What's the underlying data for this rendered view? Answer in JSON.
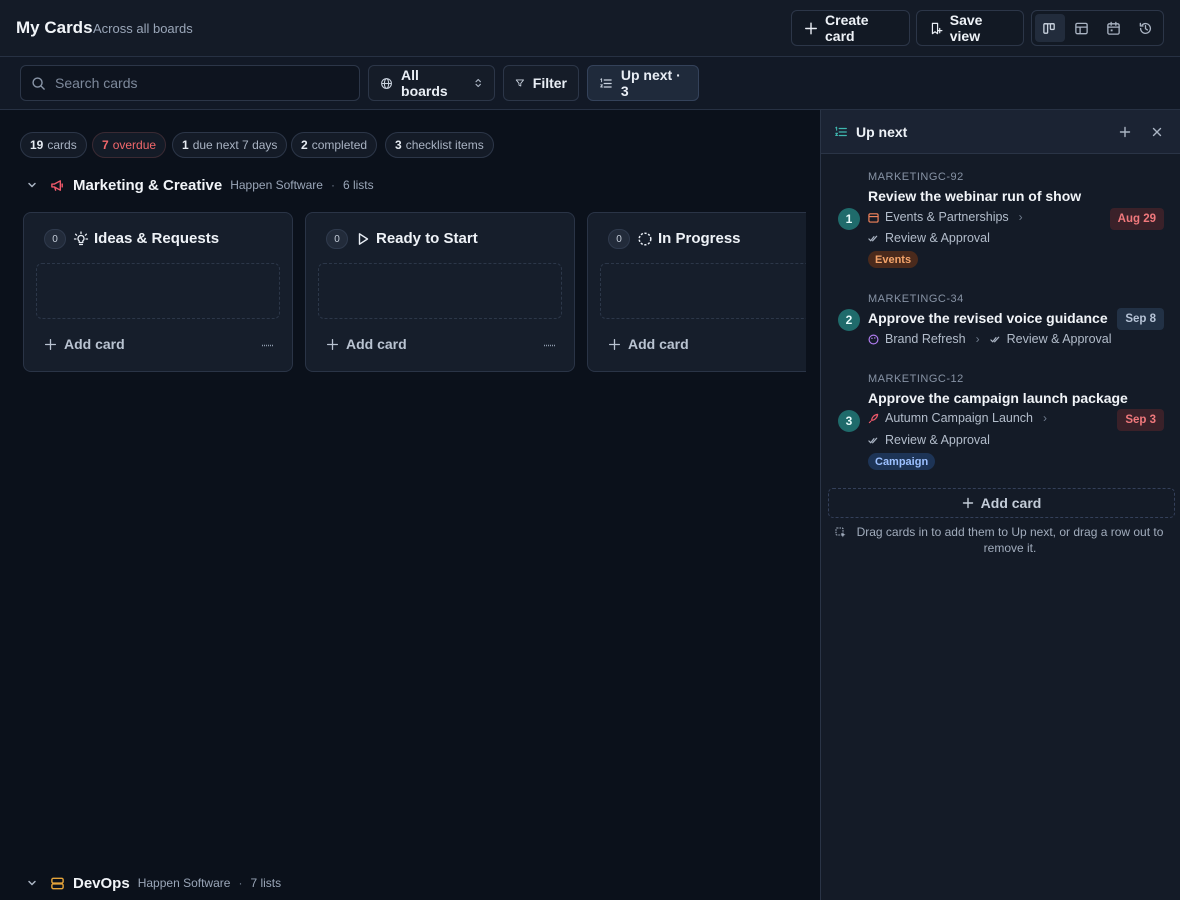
{
  "header": {
    "title": "My Cards",
    "subtitle": "Across all boards",
    "create_label": "Create card",
    "save_label": "Save view",
    "views": [
      "board-view-icon",
      "table-view-icon",
      "calendar-view-icon",
      "history-view-icon"
    ],
    "active_view": "board"
  },
  "toolbar": {
    "search_placeholder": "Search cards",
    "boards_label": "All boards",
    "filter_label": "Filter",
    "upnext_label": "Up next · 3"
  },
  "stats": [
    {
      "value": "19",
      "label": "cards"
    },
    {
      "value": "7",
      "label": "overdue"
    },
    {
      "value": "1",
      "label": "due next 7 days"
    },
    {
      "value": "2",
      "label": "completed"
    },
    {
      "value": "3",
      "label": "checklist items"
    }
  ],
  "groups": [
    {
      "name": "Marketing & Creative",
      "org": "Happen Software",
      "sep": "·",
      "lists_label": "6 lists",
      "icon": "megaphone-icon",
      "color": "#f0596b",
      "lists": [
        {
          "count": "0",
          "name": "Ideas & Requests",
          "icon": "lightbulb-icon",
          "add_label": "Add card"
        },
        {
          "count": "0",
          "name": "Ready to Start",
          "icon": "play-icon",
          "add_label": "Add card"
        },
        {
          "count": "0",
          "name": "In Progress",
          "icon": "progress-circle-icon",
          "add_label": "Add card"
        }
      ]
    },
    {
      "name": "DevOps",
      "org": "Happen Software",
      "sep": "·",
      "lists_label": "7 lists",
      "icon": "server-icon",
      "color": "#e5a43a"
    }
  ],
  "panel": {
    "title": "Up next",
    "cards": [
      {
        "n": "1",
        "key": "MARKETINGC-92",
        "title": "Review the webinar run of show",
        "board": "Events & Partnerships",
        "list": "Review & Approval",
        "tag": "Events",
        "due": "Aug 29",
        "due_state": "overdue"
      },
      {
        "n": "2",
        "key": "MARKETINGC-34",
        "title": "Approve the revised voice guidance",
        "board": "Brand Refresh",
        "list": "Review & Approval",
        "due": "Sep 8",
        "due_state": "upcoming"
      },
      {
        "n": "3",
        "key": "MARKETINGC-12",
        "title": "Approve the campaign launch package",
        "board": "Autumn Campaign Launch",
        "list": "Review & Approval",
        "tag": "Campaign",
        "due": "Sep 3",
        "due_state": "overdue"
      }
    ],
    "add_label": "Add card",
    "hint": "Drag cards in to add them to Up next, or drag a row out to remove it."
  },
  "colors": {
    "accent_teal": "#1f6b6b",
    "overdue": "#f0787c",
    "tag_events": "#f4a46a",
    "tag_campaign": "#9cc0ff"
  }
}
